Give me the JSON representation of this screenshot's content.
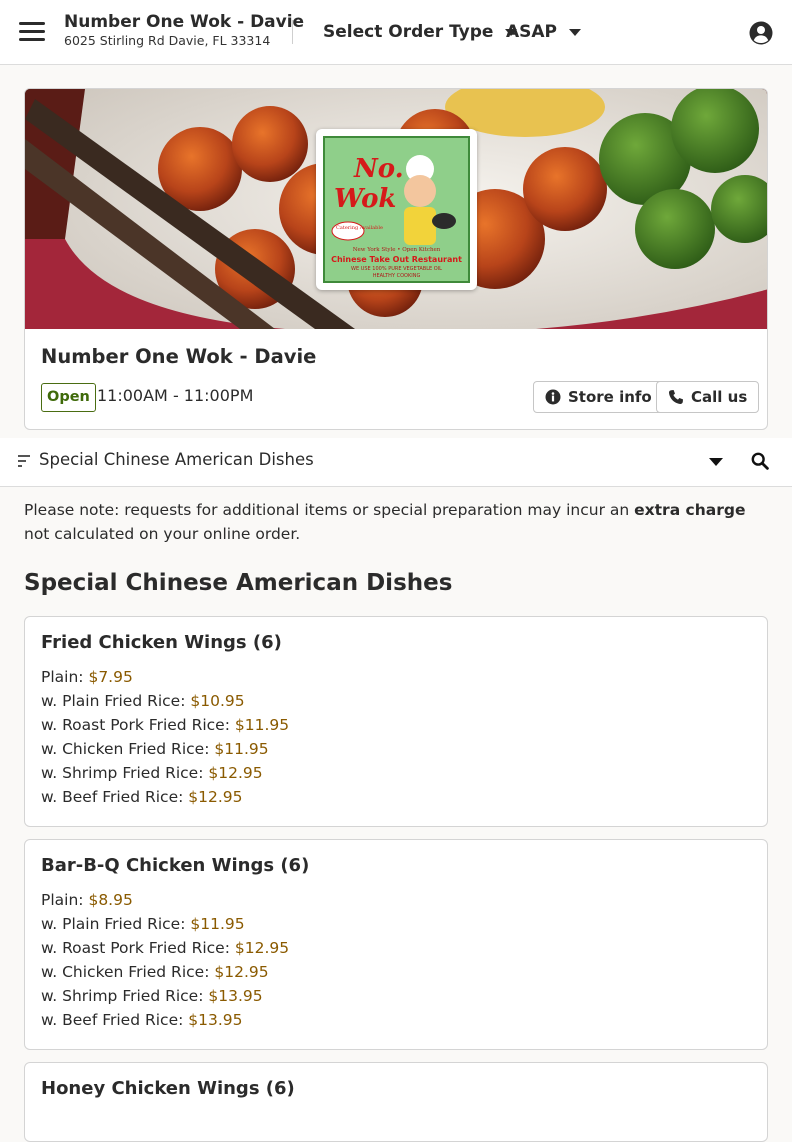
{
  "header": {
    "store_name": "Number One Wok - Davie",
    "store_address": "6025 Stirling Rd Davie, FL 33314",
    "order_type_label": "Select Order Type",
    "time_label": "ASAP",
    "icons": {
      "menu": "hamburger-menu-icon",
      "account": "user-circle-icon"
    }
  },
  "store_card": {
    "title": "Number One Wok - Davie",
    "status": "Open",
    "hours": "11:00AM - 11:00PM",
    "store_info_label": "Store info",
    "call_label": "Call us",
    "logo": {
      "line1": "No. 1",
      "line2": "Wok",
      "tag": "Catering Available",
      "subtitle": "New York Style • Open Kitchen",
      "name": "Chinese Take Out Restaurant",
      "oil": "WE USE 100% PURE VEGETABLE OIL",
      "healthy": "HEALTHY COOKING"
    }
  },
  "category_bar": {
    "selected": "Special Chinese American Dishes"
  },
  "notice": {
    "before": "Please note: requests for additional items or special preparation may incur an ",
    "emphasis": "extra charge",
    "after": " not calculated on your online order."
  },
  "section": {
    "title": "Special Chinese American Dishes",
    "items": [
      {
        "name": "Fried Chicken Wings (6)",
        "options": [
          {
            "label": "Plain:",
            "price": "$7.95"
          },
          {
            "label": "w. Plain Fried Rice:",
            "price": "$10.95"
          },
          {
            "label": "w. Roast Pork Fried Rice:",
            "price": "$11.95"
          },
          {
            "label": "w. Chicken Fried Rice:",
            "price": "$11.95"
          },
          {
            "label": "w. Shrimp Fried Rice:",
            "price": "$12.95"
          },
          {
            "label": "w. Beef Fried Rice:",
            "price": "$12.95"
          }
        ]
      },
      {
        "name": "Bar-B-Q Chicken Wings (6)",
        "options": [
          {
            "label": "Plain:",
            "price": "$8.95"
          },
          {
            "label": "w. Plain Fried Rice:",
            "price": "$11.95"
          },
          {
            "label": "w. Roast Pork Fried Rice:",
            "price": "$12.95"
          },
          {
            "label": "w. Chicken Fried Rice:",
            "price": "$12.95"
          },
          {
            "label": "w. Shrimp Fried Rice:",
            "price": "$13.95"
          },
          {
            "label": "w. Beef Fried Rice:",
            "price": "$13.95"
          }
        ]
      },
      {
        "name": "Honey Chicken Wings (6)",
        "options": []
      }
    ]
  },
  "colors": {
    "price": "#8a5a00",
    "open_badge": "#3f6a0a",
    "text": "#2b2b2b"
  }
}
